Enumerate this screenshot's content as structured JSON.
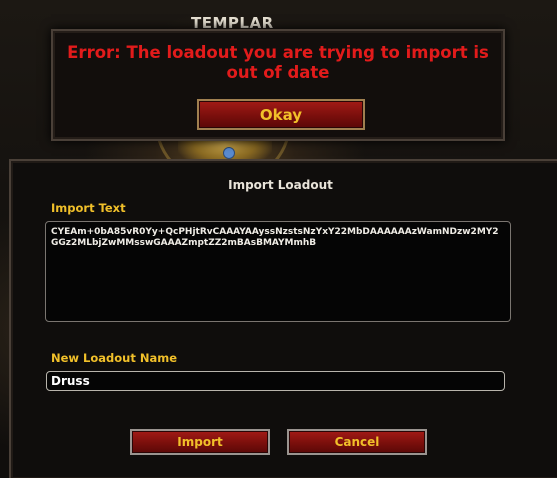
{
  "background": {
    "class_title": "TEMPLAR"
  },
  "error_popup": {
    "message": "Error: The loadout you are trying to import is out of date",
    "okay_label": "Okay",
    "text_color": "#e21b1b",
    "button_text_color": "#f1c02a"
  },
  "import_dialog": {
    "title": "Import Loadout",
    "import_text_label": "Import Text",
    "import_text_value": "CYEAm+0bA85vR0Yy+QcPHjtRvCAAAYAAyssNzstsNzYxY22MbDAAAAAAzWamNDzw2MY2GGz2MLbjZwMMsswGAAAZmptZZ2mBAsBMAYMmhB",
    "name_label": "New Loadout Name",
    "name_value": "Druss",
    "import_button_label": "Import",
    "cancel_button_label": "Cancel",
    "label_color": "#f1c02a"
  }
}
